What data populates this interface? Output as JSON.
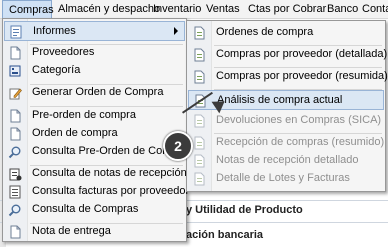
{
  "menubar": {
    "items": [
      {
        "label": "Compras",
        "active": true
      },
      {
        "label": "Almacén y despacho"
      },
      {
        "label": "Inventario"
      },
      {
        "label": "Ventas"
      },
      {
        "label": "Ctas por Cobrar"
      },
      {
        "label": "Banco"
      },
      {
        "label": "Conta"
      }
    ]
  },
  "background": {
    "label_1": "y Utilidad de Producto",
    "label_2": "ación bancaria"
  },
  "compras_menu": {
    "items": [
      {
        "label": "Informes",
        "icon": "report-icon",
        "has_submenu": true,
        "highlighted": true
      },
      {
        "label": "Proveedores",
        "icon": "document-icon"
      },
      {
        "label": "Categoría",
        "icon": "category-icon"
      },
      {
        "label": "Generar Orden de Compra",
        "icon": "pencil-icon"
      },
      {
        "label": "Pre-orden de compra",
        "icon": "document-icon"
      },
      {
        "label": "Orden de compra",
        "icon": "document-icon"
      },
      {
        "label": "Consulta Pre-Orden de Compra",
        "icon": "search-icon"
      },
      {
        "label": "Consulta de notas de recepción",
        "icon": "receipt-icon"
      },
      {
        "label": "Consulta facturas por proveedor",
        "icon": "invoice-icon"
      },
      {
        "label": "Consulta de Compras",
        "icon": "search-icon"
      },
      {
        "label": "Nota de entrega",
        "icon": "document-icon"
      }
    ]
  },
  "informes_submenu": {
    "items": [
      {
        "label": "Ordenes de compra",
        "enabled": true
      },
      {
        "label": "Compras por proveedor (detallada)",
        "enabled": true
      },
      {
        "label": "Compras por proveedor (resumida)",
        "enabled": true
      },
      {
        "label": "Análisis de compra actual",
        "enabled": true,
        "highlighted": true
      },
      {
        "label": "Devoluciones en Compras (SICA)",
        "enabled": false
      },
      {
        "label": "Recepción de compras (resumido)",
        "enabled": false
      },
      {
        "label": "Notas de recepción detallado",
        "enabled": false
      },
      {
        "label": "Detalle de Lotes y Facturas",
        "enabled": false
      }
    ]
  },
  "callout": {
    "number": "2"
  },
  "colors": {
    "highlight": "#dbe7f4",
    "highlight_border": "#99b4d6",
    "callout": "#3b3b3b"
  }
}
